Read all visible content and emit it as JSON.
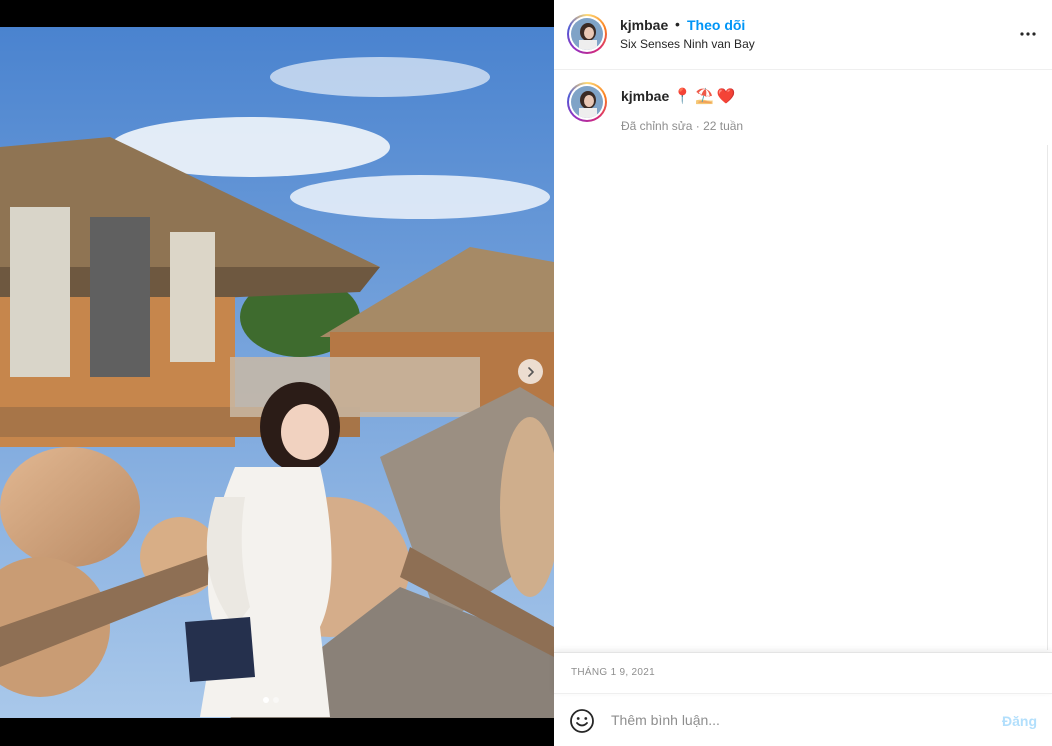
{
  "post": {
    "username": "kjmbae",
    "follow_label": "Theo dõi",
    "separator": "•",
    "location": "Six Senses Ninh van Bay"
  },
  "caption": {
    "username": "kjmbae",
    "emojis": [
      "📍",
      "⛱️",
      "❤️"
    ],
    "meta": "Đã chỉnh sửa · 22 tuần"
  },
  "date": "THÁNG 1 9, 2021",
  "comment": {
    "placeholder": "Thêm bình luận...",
    "post_label": "Đăng"
  },
  "carousel": {
    "slide_count": 2,
    "active_index": 0
  },
  "icons": {
    "more": "more-options-icon",
    "emoji": "emoji-icon",
    "next": "chevron-right-icon"
  }
}
